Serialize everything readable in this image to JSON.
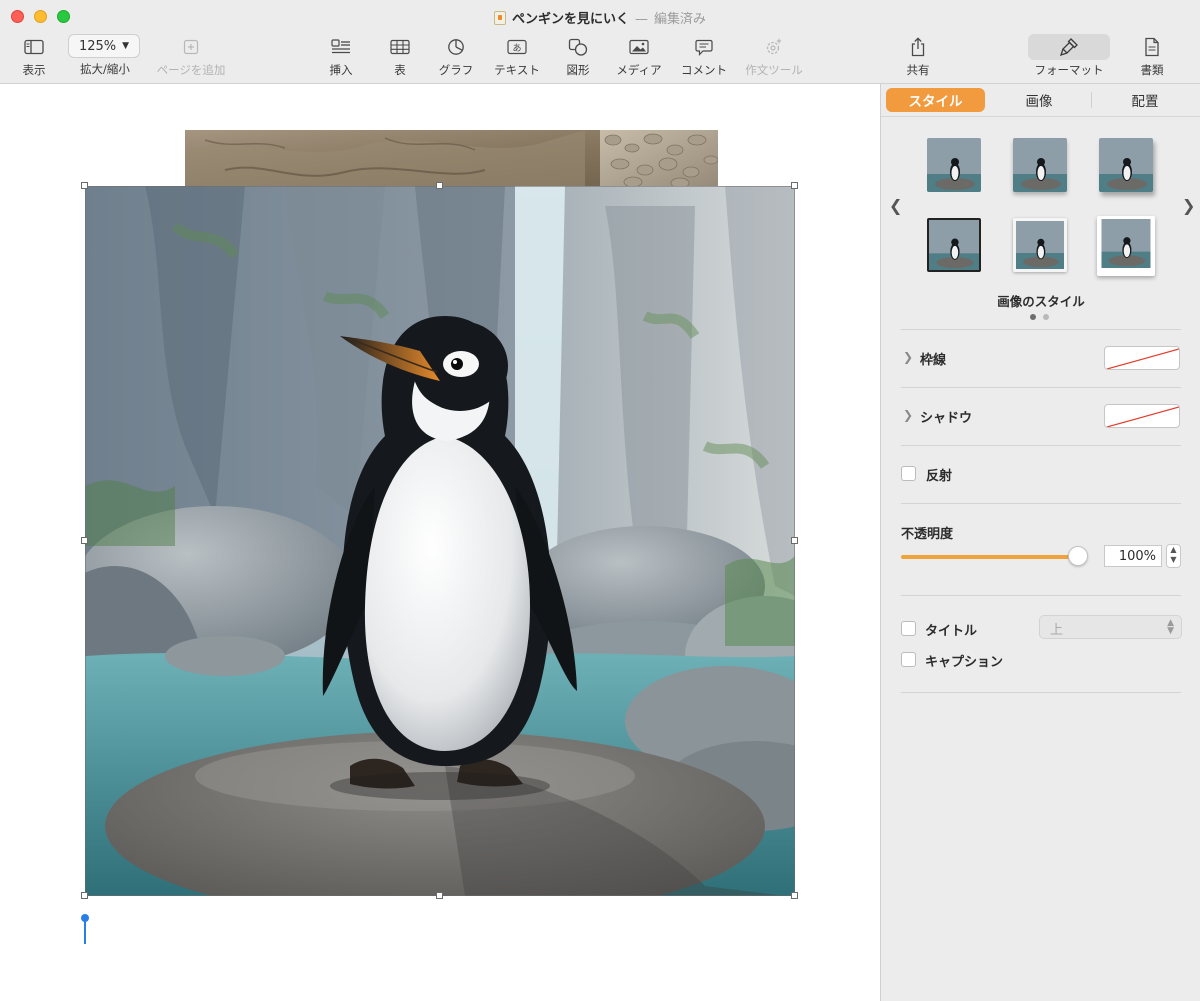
{
  "window": {
    "title": "ペンギンを見にいく",
    "separator": "—",
    "status": "編集済み"
  },
  "toolbar": {
    "view_label": "表示",
    "zoom_value": "125%",
    "zoom_label": "拡大/縮小",
    "add_page_label": "ページを追加",
    "insert_label": "挿入",
    "table_label": "表",
    "chart_label": "グラフ",
    "text_label": "テキスト",
    "shape_label": "図形",
    "media_label": "メディア",
    "comment_label": "コメント",
    "writing_tools_label": "作文ツール",
    "share_label": "共有",
    "format_label": "フォーマット",
    "document_label": "書類"
  },
  "sidebar": {
    "tabs": [
      "スタイル",
      "画像",
      "配置"
    ],
    "active_tab": "スタイル",
    "image_styles_label": "画像のスタイル",
    "page_dots": {
      "count": 2,
      "active": 1
    },
    "border_label": "枠線",
    "shadow_label": "シャドウ",
    "reflection_label": "反射",
    "opacity_label": "不透明度",
    "opacity_value_text": "100%",
    "opacity_level": 1.0,
    "title_label": "タイトル",
    "title_position": "上",
    "caption_label": "キャプション"
  },
  "colors": {
    "accent": "#f19a3e",
    "cursor": "#2a7fe6"
  },
  "icons": {
    "view": "sidebar-icon",
    "add_page": "plus-square-icon",
    "insert": "list-insert-icon",
    "table": "table-icon",
    "chart": "chart-pie-icon",
    "text": "text-box-icon",
    "shape": "shape-icon",
    "media": "photo-icon",
    "comment": "comment-icon",
    "writing_tools": "sparkle-gear-icon",
    "share": "share-icon",
    "format": "paintbrush-icon",
    "document": "document-icon"
  }
}
